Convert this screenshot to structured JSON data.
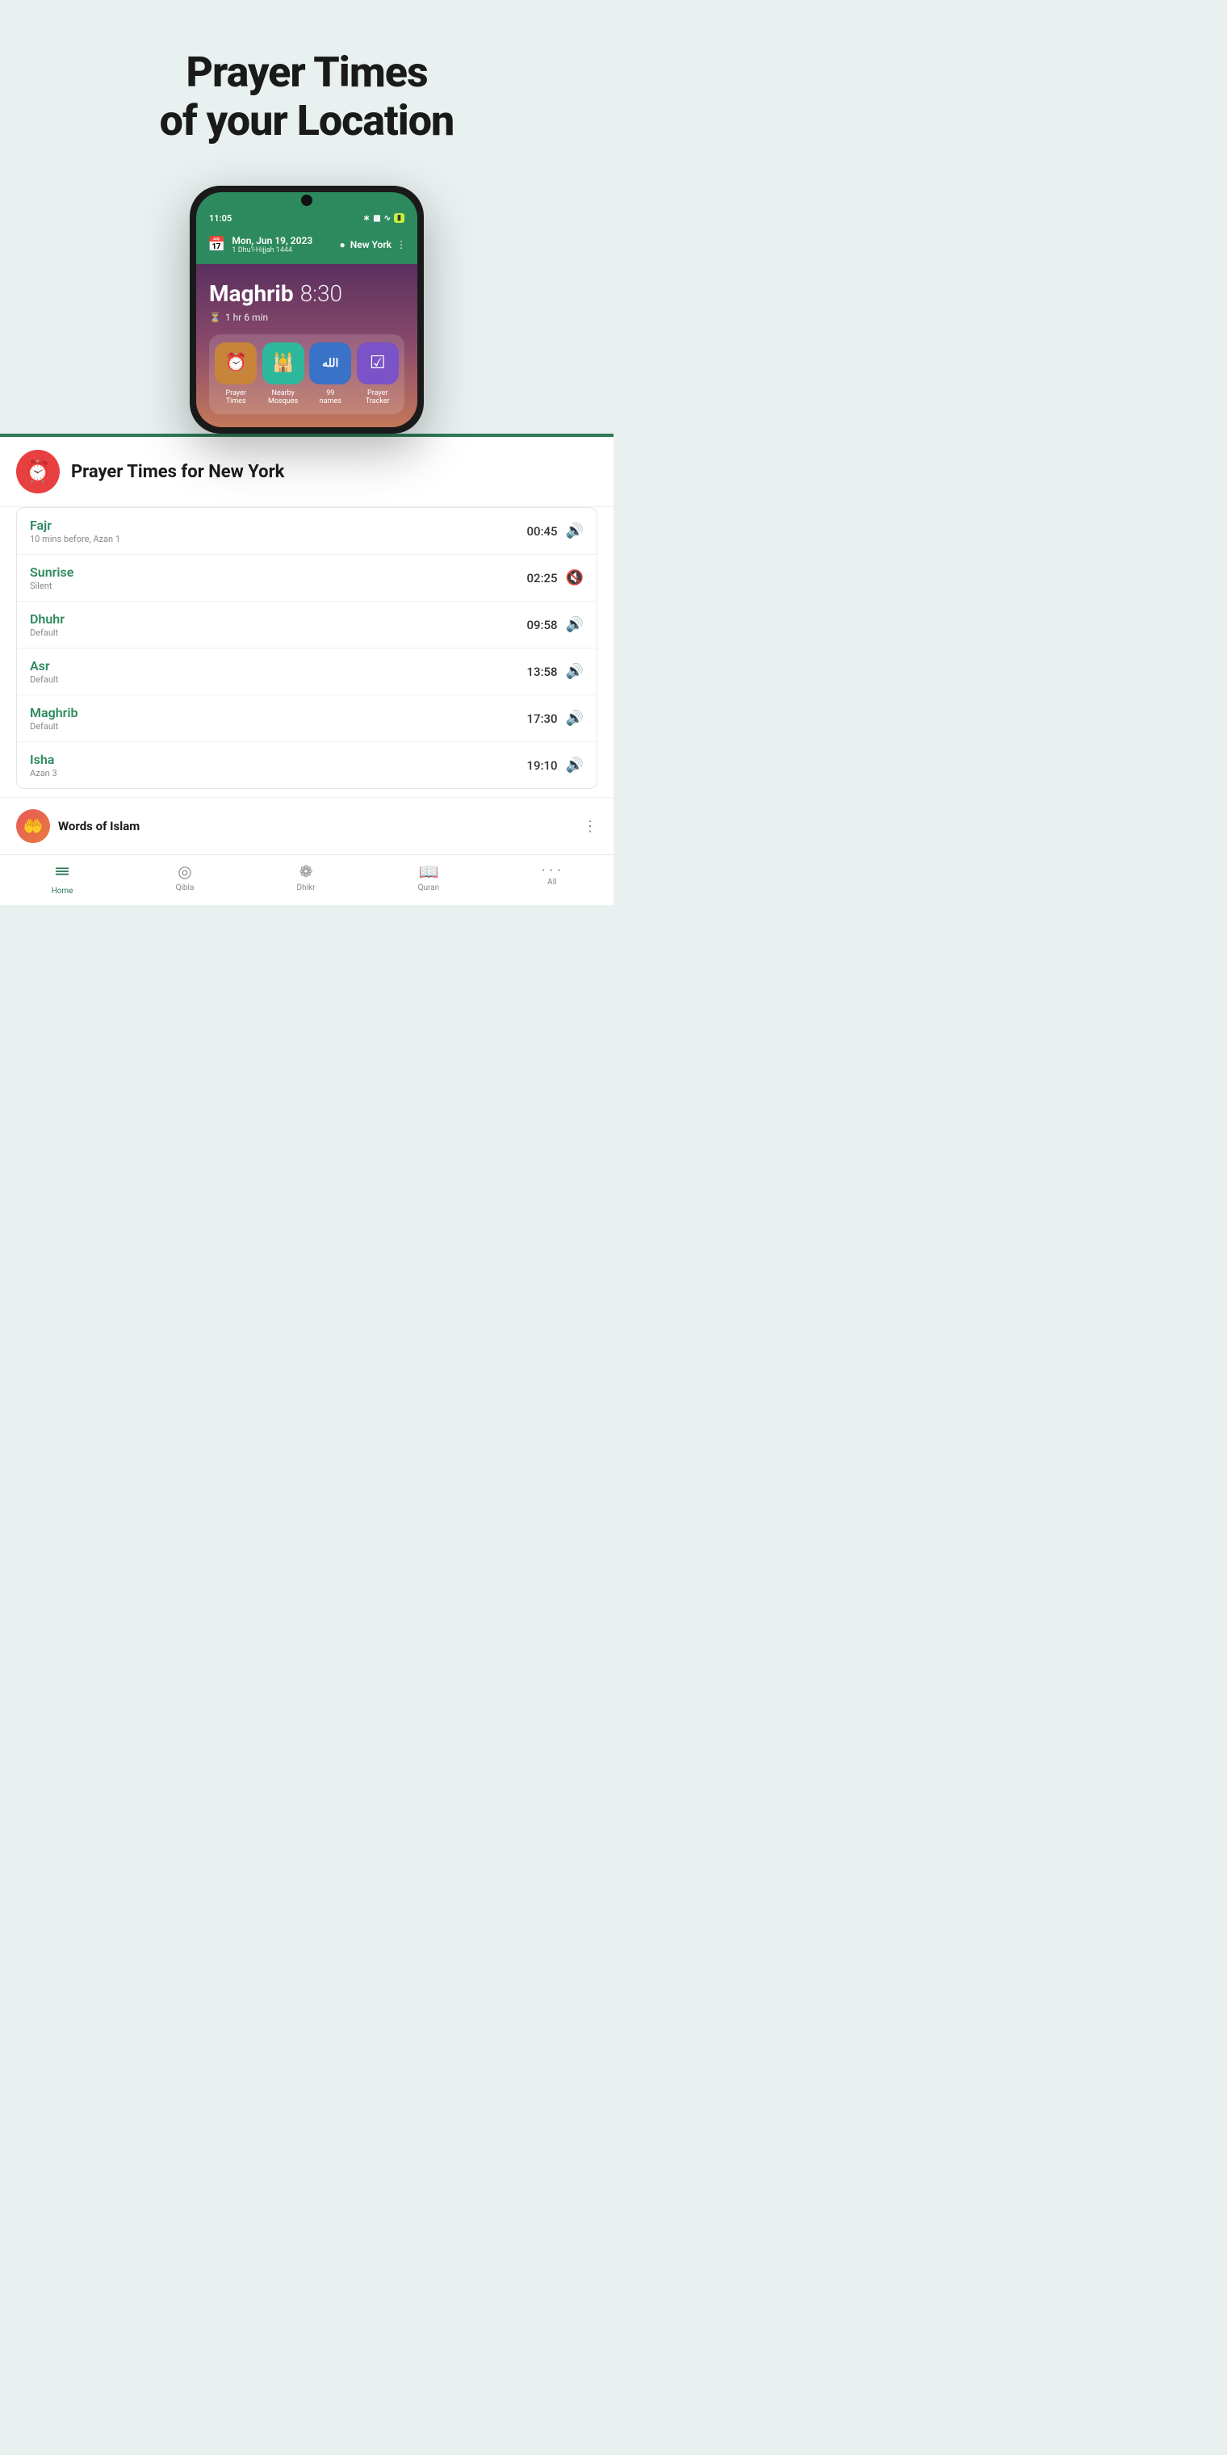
{
  "hero": {
    "title_line1": "Prayer Times",
    "title_line2": "of your Location"
  },
  "phone": {
    "status_bar": {
      "time": "11:05",
      "icons": [
        "bluetooth",
        "vibrate",
        "wifi",
        "battery"
      ]
    },
    "header": {
      "date": "Mon, Jun 19, 2023",
      "hijri": "1 Dhu'l-Hijjah 1444",
      "location": "New York"
    },
    "next_prayer": {
      "name": "Maghrib",
      "time": "8:30",
      "countdown": "1 hr 6 min"
    },
    "quick_links": [
      {
        "label": "Prayer\nTimes",
        "icon": "⏰",
        "color": "gold"
      },
      {
        "label": "Nearby\nMosques",
        "icon": "🕌",
        "color": "teal"
      },
      {
        "label": "99\nnames",
        "icon": "☪",
        "color": "blue"
      },
      {
        "label": "Prayer\nTracker",
        "icon": "☑",
        "color": "purple"
      }
    ]
  },
  "prayer_times_header": {
    "title": "Prayer Times for New York",
    "icon": "⏰"
  },
  "prayer_list": [
    {
      "name": "Fajr",
      "sub": "10 mins before, Azan 1",
      "time": "00:45",
      "sound": true
    },
    {
      "name": "Sunrise",
      "sub": "Silent",
      "time": "02:25",
      "sound": false
    },
    {
      "name": "Dhuhr",
      "sub": "Default",
      "time": "09:58",
      "sound": true
    },
    {
      "name": "Asr",
      "sub": "Default",
      "time": "13:58",
      "sound": true
    },
    {
      "name": "Maghrib",
      "sub": "Default",
      "time": "17:30",
      "sound": true
    },
    {
      "name": "Isha",
      "sub": "Azan 3",
      "time": "19:10",
      "sound": true
    }
  ],
  "words_of_islam": {
    "title": "Words of Islam"
  },
  "bottom_nav": [
    {
      "label": "Home",
      "icon": "☰",
      "active": true
    },
    {
      "label": "Qibla",
      "icon": "◎",
      "active": false
    },
    {
      "label": "Dhikr",
      "icon": "❁",
      "active": false
    },
    {
      "label": "Quran",
      "icon": "📖",
      "active": false
    },
    {
      "label": "All",
      "icon": "•••",
      "active": false
    }
  ]
}
